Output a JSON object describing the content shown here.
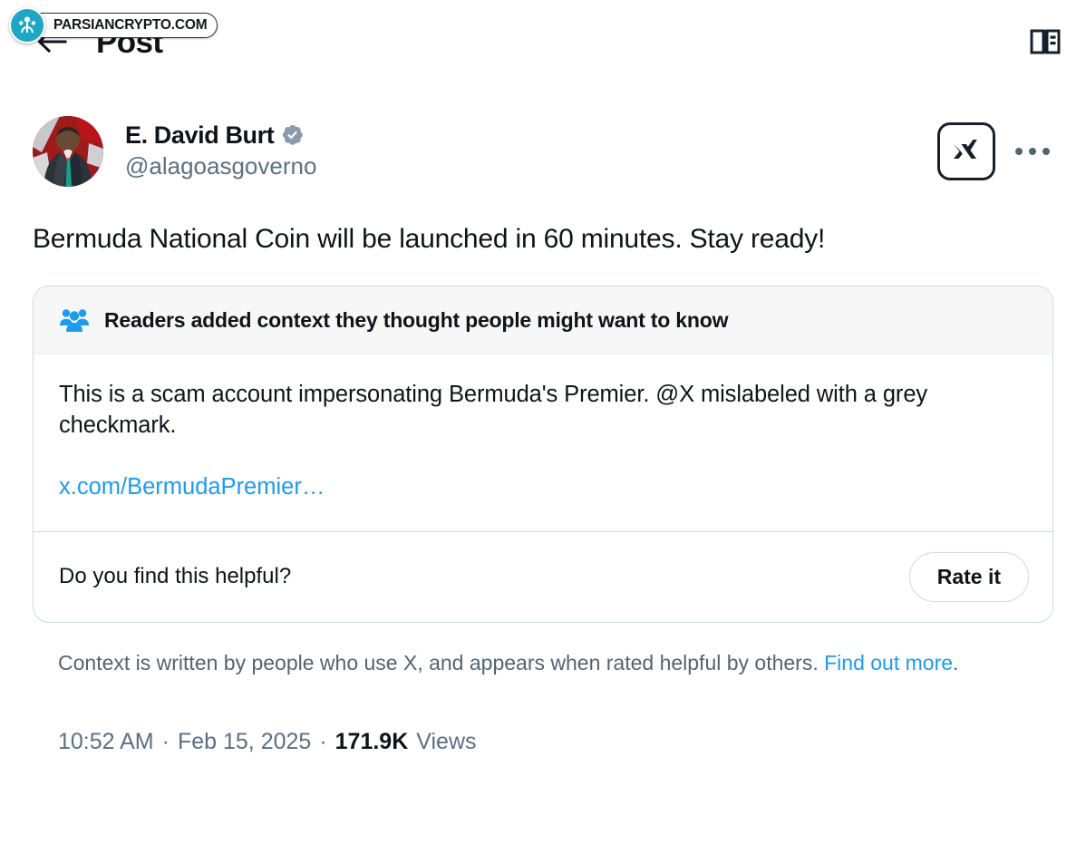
{
  "watermark": {
    "text": "PARSIANCRYPTO.COM",
    "logo_icon": "parsiancrypto-logo-icon",
    "logo_color": "#1ea7c5"
  },
  "header": {
    "back_icon": "back-arrow-icon",
    "title": "Post",
    "reader_icon": "reader-book-icon"
  },
  "post": {
    "author": {
      "avatar_icon": "user-avatar",
      "display_name": "E. David Burt",
      "verified_badge_icon": "verified-grey-check-icon",
      "verified_badge_color": "#8899a6",
      "handle": "@alagoasgoverno"
    },
    "actions": {
      "xai_button_icon": "xai-logo-icon",
      "more_button_icon": "more-options-icon"
    },
    "text": "Bermuda National Coin will be launched in 60 minutes. Stay ready!",
    "timestamp_time": "10:52 AM",
    "timestamp_date": "Feb 15, 2025",
    "views_count": "171.9K",
    "views_label": "Views",
    "separator": "·"
  },
  "community_note": {
    "icon": "community-people-icon",
    "icon_color": "#1d9bf0",
    "header": "Readers added context they thought people might want to know",
    "body": "This is a scam account impersonating Bermuda's Premier. @X mislabeled with a grey checkmark.",
    "link": "x.com/BermudaPremier…",
    "helpful_prompt": "Do you find this helpful?",
    "rate_button": "Rate it"
  },
  "disclaimer": {
    "text": "Context is written by people who use X, and appears when rated helpful by others. ",
    "link": "Find out more",
    "trailing": "."
  },
  "colors": {
    "accent_blue": "#1d9bf0",
    "text_primary": "#0f1419",
    "text_secondary": "#536471",
    "border": "#cfd9de"
  }
}
